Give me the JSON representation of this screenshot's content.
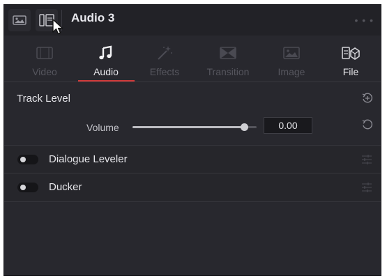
{
  "header": {
    "title": "Audio 3",
    "image_button_icon": "image-icon",
    "split_view_button_icon": "split-view-icon",
    "more_icon": "more-options-icon",
    "more_glyph": "• • •"
  },
  "tabs": [
    {
      "label": "Video",
      "icon": "video-icon",
      "state": "disabled"
    },
    {
      "label": "Audio",
      "icon": "music-note-icon",
      "state": "active"
    },
    {
      "label": "Effects",
      "icon": "magic-wand-icon",
      "state": "disabled"
    },
    {
      "label": "Transition",
      "icon": "transition-icon",
      "state": "disabled"
    },
    {
      "label": "Image",
      "icon": "image-icon",
      "state": "disabled"
    },
    {
      "label": "File",
      "icon": "file-icon",
      "state": "enabled"
    }
  ],
  "track_level": {
    "title": "Track Level",
    "volume_label": "Volume",
    "volume_value": "0.00",
    "volume_slider_fraction": 0.9
  },
  "effects": [
    {
      "label": "Dialogue Leveler",
      "enabled": false
    },
    {
      "label": "Ducker",
      "enabled": false
    }
  ],
  "colors": {
    "panel_bg": "#28282e",
    "header_bg": "#222227",
    "accent_underline": "#d13a3a",
    "text_primary": "#e6e6ea",
    "text_disabled": "#56565e"
  }
}
